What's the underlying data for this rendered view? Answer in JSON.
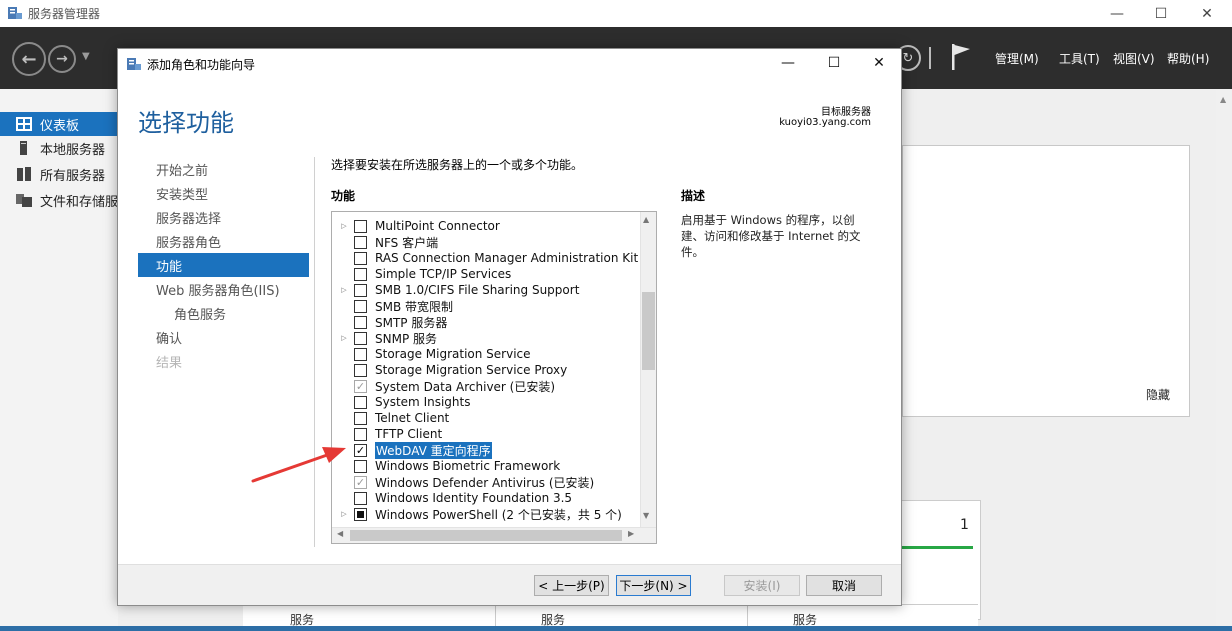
{
  "server_manager": {
    "title": "服务器管理器",
    "window_controls": {
      "minimize": "—",
      "maximize": "☐",
      "close": "✕"
    },
    "menu": {
      "manage": "管理(M)",
      "tools": "工具(T)",
      "view": "视图(V)",
      "help": "帮助(H)"
    },
    "sidebar": {
      "items": [
        {
          "label": "仪表板",
          "icon": "dashboard-icon",
          "active": true
        },
        {
          "label": "本地服务器",
          "icon": "server-icon",
          "active": false
        },
        {
          "label": "所有服务器",
          "icon": "servers-icon",
          "active": false
        },
        {
          "label": "文件和存储服务",
          "icon": "storage-icon",
          "active": false
        }
      ]
    },
    "hide_link": "隐藏",
    "tile_count": "1",
    "bottom_labels": [
      "服务",
      "服务",
      "服务"
    ]
  },
  "wizard": {
    "title": "添加角色和功能向导",
    "window_controls": {
      "minimize": "—",
      "maximize": "☐",
      "close": "✕"
    },
    "heading": "选择功能",
    "target_label": "目标服务器",
    "target_value": "kuoyi03.yang.com",
    "nav": [
      {
        "label": "开始之前",
        "state": "normal"
      },
      {
        "label": "安装类型",
        "state": "normal"
      },
      {
        "label": "服务器选择",
        "state": "normal"
      },
      {
        "label": "服务器角色",
        "state": "normal"
      },
      {
        "label": "功能",
        "state": "active"
      },
      {
        "label": "Web 服务器角色(IIS)",
        "state": "normal"
      },
      {
        "label": "角色服务",
        "state": "sub"
      },
      {
        "label": "确认",
        "state": "normal"
      },
      {
        "label": "结果",
        "state": "disabled"
      }
    ],
    "instruction": "选择要安装在所选服务器上的一个或多个功能。",
    "features_label": "功能",
    "description_label": "描述",
    "description_text": "启用基于 Windows 的程序，以创建、访问和修改基于 Internet 的文件。",
    "features": [
      {
        "label": "MultiPoint Connector",
        "expander": true,
        "state": "unchecked"
      },
      {
        "label": "NFS 客户端",
        "expander": false,
        "state": "unchecked"
      },
      {
        "label": "RAS Connection Manager Administration Kit (",
        "expander": false,
        "state": "unchecked"
      },
      {
        "label": "Simple TCP/IP Services",
        "expander": false,
        "state": "unchecked"
      },
      {
        "label": "SMB 1.0/CIFS File Sharing Support",
        "expander": true,
        "state": "unchecked"
      },
      {
        "label": "SMB 带宽限制",
        "expander": false,
        "state": "unchecked"
      },
      {
        "label": "SMTP 服务器",
        "expander": false,
        "state": "unchecked"
      },
      {
        "label": "SNMP 服务",
        "expander": true,
        "state": "unchecked"
      },
      {
        "label": "Storage Migration Service",
        "expander": false,
        "state": "unchecked"
      },
      {
        "label": "Storage Migration Service Proxy",
        "expander": false,
        "state": "unchecked"
      },
      {
        "label": "System Data Archiver (已安装)",
        "expander": false,
        "state": "installed"
      },
      {
        "label": "System Insights",
        "expander": false,
        "state": "unchecked"
      },
      {
        "label": "Telnet Client",
        "expander": false,
        "state": "unchecked"
      },
      {
        "label": "TFTP Client",
        "expander": false,
        "state": "unchecked"
      },
      {
        "label": "WebDAV 重定向程序",
        "expander": false,
        "state": "checked",
        "selected": true
      },
      {
        "label": "Windows Biometric Framework",
        "expander": false,
        "state": "unchecked"
      },
      {
        "label": "Windows Defender Antivirus (已安装)",
        "expander": false,
        "state": "installed"
      },
      {
        "label": "Windows Identity Foundation 3.5",
        "expander": false,
        "state": "unchecked"
      },
      {
        "label": "Windows PowerShell (2 个已安装，共 5 个)",
        "expander": true,
        "state": "partial"
      }
    ],
    "buttons": {
      "prev": "< 上一步(P)",
      "next": "下一步(N) >",
      "install": "安装(I)",
      "cancel": "取消"
    }
  },
  "colors": {
    "accent": "#1b72be",
    "heading": "#1e5f9e",
    "header_bg": "#2d2d2d",
    "annotation_arrow": "#e53935"
  }
}
